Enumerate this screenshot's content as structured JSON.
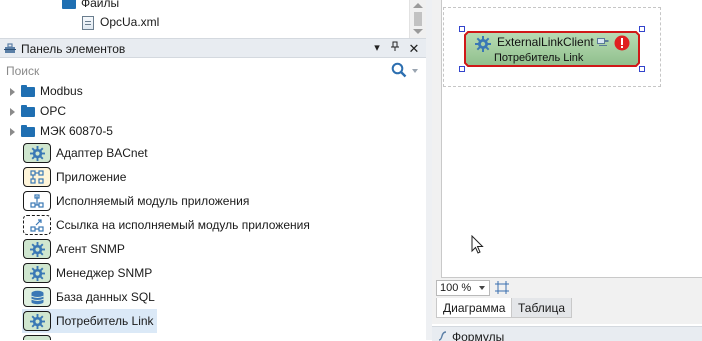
{
  "tree": {
    "folder_label": "Файлы",
    "file_label": "OpcUa.xml"
  },
  "panel": {
    "title": "Панель элементов",
    "search_placeholder": "Поиск",
    "groups": [
      {
        "label": "Modbus"
      },
      {
        "label": "OPC"
      },
      {
        "label": "МЭК 60870-5"
      }
    ],
    "items": [
      {
        "label": "Адаптер BACnet",
        "icon": "gear-icon"
      },
      {
        "label": "Приложение",
        "icon": "app-icon"
      },
      {
        "label": "Исполняемый модуль приложения",
        "icon": "module-icon"
      },
      {
        "label": "Ссылка на исполняемый модуль приложения",
        "icon": "module-link-icon"
      },
      {
        "label": "Агент SNMP",
        "icon": "gear-icon"
      },
      {
        "label": "Менеджер SNMP",
        "icon": "gear-icon"
      },
      {
        "label": "База данных SQL",
        "icon": "database-icon"
      },
      {
        "label": "Потребитель Link",
        "icon": "gear-icon",
        "selected": true
      }
    ]
  },
  "diagram": {
    "block_title": "ExternalLinkClient",
    "block_subtitle": "Потребитель Link",
    "zoom": "100 %"
  },
  "tabs": [
    {
      "label": "Диаграмма",
      "active": true
    },
    {
      "label": "Таблица",
      "active": false
    }
  ],
  "formulas": {
    "title": "Формулы"
  },
  "colors": {
    "block_fill": "#9fcf9f",
    "block_border": "#d01818",
    "error": "#e02020",
    "selection": "#dbe9f7"
  }
}
